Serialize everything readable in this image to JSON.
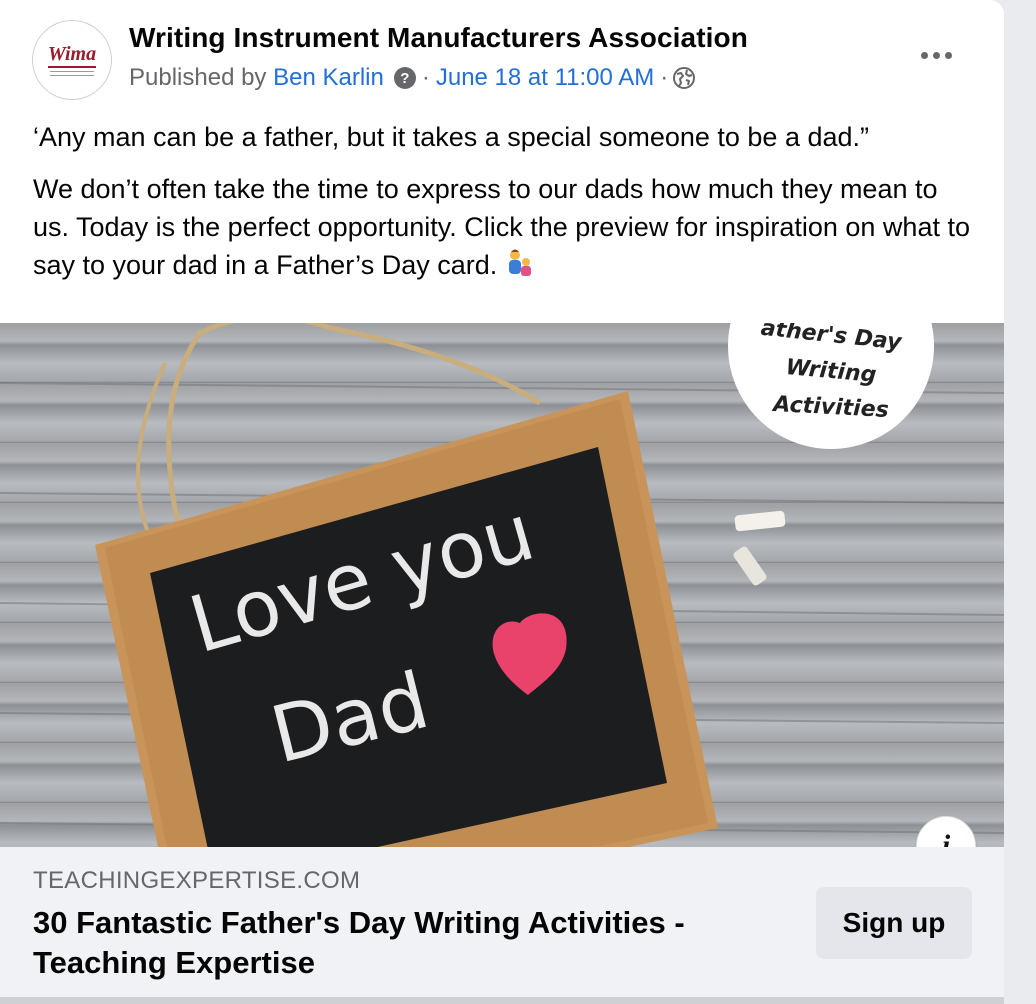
{
  "post": {
    "page_name": "Writing Instrument Manufacturers Association",
    "avatar_logo": "Wima",
    "published_by_prefix": "Published by",
    "author": "Ben Karlin",
    "help_icon": "?",
    "separator": "·",
    "timestamp": "June 18 at 11:00 AM",
    "audience_icon": "globe-icon",
    "more_icon": "ellipsis-icon",
    "quote": "‘Any man can be a father, but it takes a special someone to be a dad.”",
    "body": "We don’t often take the time to express to our dads how much they mean to us. Today is the perfect opportunity. Click the preview for inspiration on what to say to your dad in a Father’s Day card.",
    "body_emoji": "family-emoji"
  },
  "preview": {
    "chalk_line1": "Love you",
    "chalk_line2": "Dad",
    "badge_line1": "ather's Day",
    "badge_line2": "Writing",
    "badge_line3": "Activities",
    "info_label": "i"
  },
  "link": {
    "domain": "TEACHINGEXPERTISE.COM",
    "title": "30 Fantastic Father's Day Writing Activities - Teaching Expertise",
    "cta_label": "Sign up"
  },
  "colors": {
    "link_blue": "#216fdb",
    "meta_gray": "#65676b",
    "footer_bg": "#f0f2f5",
    "heart_pink": "#e9426b"
  }
}
